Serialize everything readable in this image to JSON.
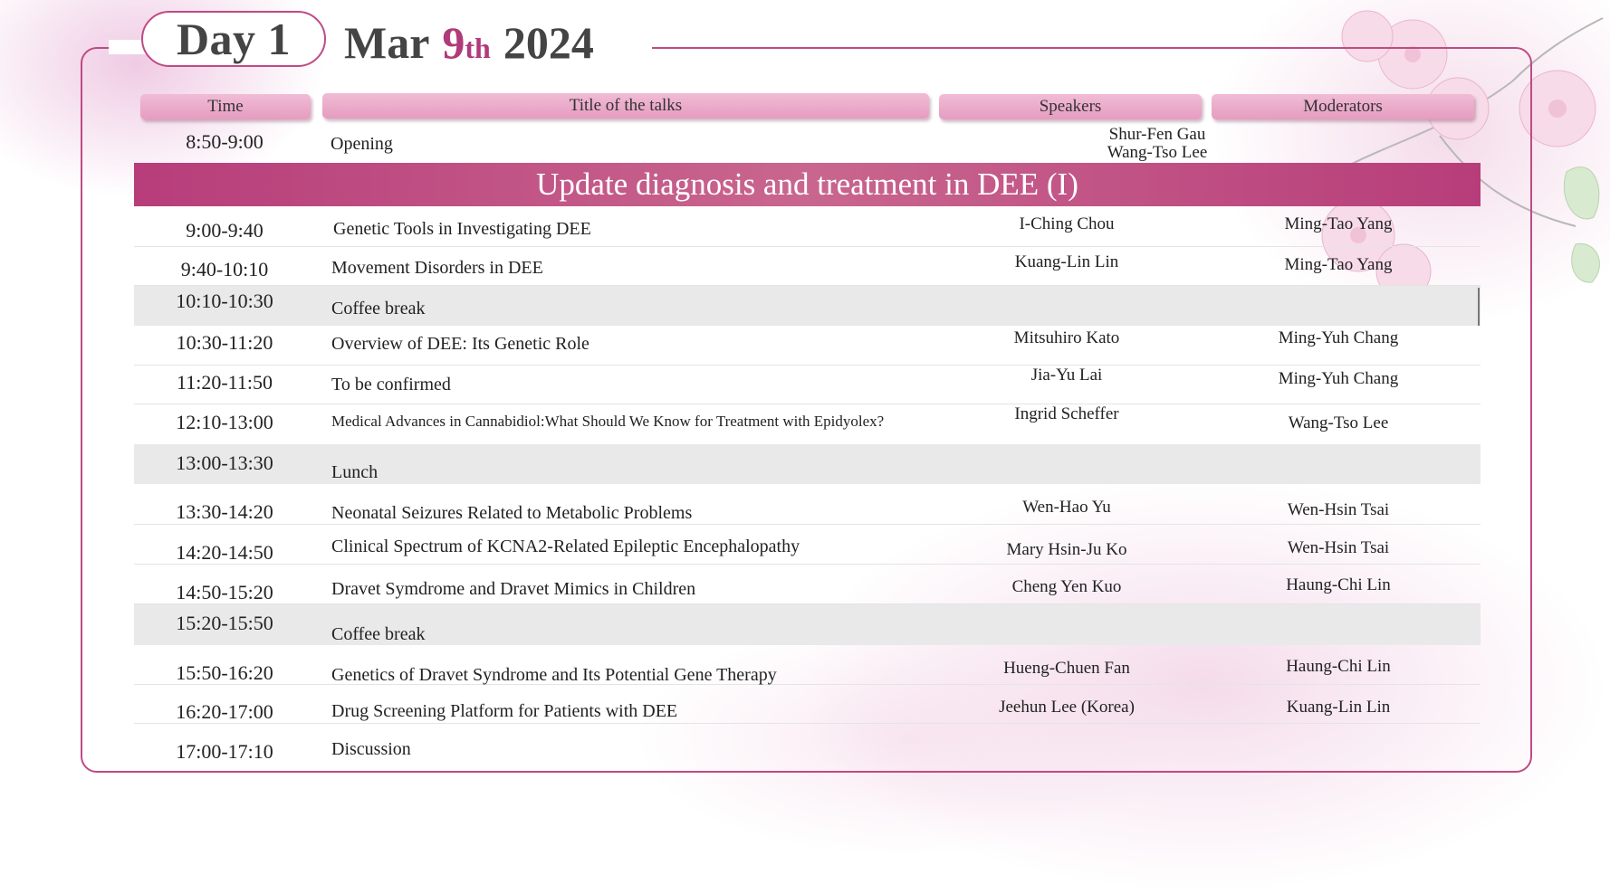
{
  "header": {
    "day_label": "Day 1",
    "month": "Mar",
    "day_number": "9",
    "day_suffix": "th",
    "year": "2024"
  },
  "columns": {
    "time": "Time",
    "title": "Title of the talks",
    "speakers": "Speakers",
    "moderators": "Moderators"
  },
  "opening": {
    "time": "8:50-9:00",
    "title": "Opening",
    "moderator_1": "Shur-Fen Gau",
    "moderator_2": "Wang-Tso Lee"
  },
  "section": {
    "title": "Update diagnosis and treatment in DEE (I)"
  },
  "rows": [
    {
      "time": "9:00-9:40",
      "title": "Genetic Tools in Investigating DEE",
      "speaker": "I-Ching Chou",
      "moderator": "Ming-Tao Yang"
    },
    {
      "time": "9:40-10:10",
      "title": "Movement Disorders in DEE",
      "speaker": "Kuang-Lin Lin",
      "moderator": "Ming-Tao Yang"
    },
    {
      "time": "10:10-10:30",
      "title": "Coffee break",
      "speaker": "",
      "moderator": ""
    },
    {
      "time": "10:30-11:20",
      "title": "Overview of DEE: Its Genetic Role",
      "speaker": "Mitsuhiro Kato",
      "moderator": "Ming-Yuh Chang"
    },
    {
      "time": "11:20-11:50",
      "title": "To be confirmed",
      "speaker": "Jia-Yu Lai",
      "moderator": "Ming-Yuh Chang"
    },
    {
      "time": "12:10-13:00",
      "title": "Medical Advances in Cannabidiol:What Should We Know for Treatment with Epidyolex?",
      "speaker": "Ingrid Scheffer",
      "moderator": "Wang-Tso Lee"
    },
    {
      "time": "13:00-13:30",
      "title": "Lunch",
      "speaker": "",
      "moderator": ""
    },
    {
      "time": "13:30-14:20",
      "title": "Neonatal Seizures Related to Metabolic Problems",
      "speaker": "Wen-Hao Yu",
      "moderator": "Wen-Hsin Tsai"
    },
    {
      "time": "14:20-14:50",
      "title": "Clinical Spectrum of  KCNA2-Related Epileptic Encephalopathy",
      "speaker": "Mary Hsin-Ju Ko",
      "moderator": "Wen-Hsin Tsai"
    },
    {
      "time": "14:50-15:20",
      "title": "Dravet Symdrome and Dravet Mimics in Children",
      "speaker": "Cheng Yen Kuo",
      "moderator": "Haung-Chi Lin"
    },
    {
      "time": "15:20-15:50",
      "title": "Coffee break",
      "speaker": "",
      "moderator": ""
    },
    {
      "time": "15:50-16:20",
      "title": "Genetics of  Dravet Syndrome and Its Potential Gene Therapy",
      "speaker": "Hueng-Chuen Fan",
      "moderator": "Haung-Chi Lin"
    },
    {
      "time": "16:20-17:00",
      "title": "Drug Screening Platform for Patients with DEE",
      "speaker": "Jeehun Lee (Korea)",
      "moderator": "Kuang-Lin Lin"
    },
    {
      "time": "17:00-17:10",
      "title": "Discussion",
      "speaker": "",
      "moderator": ""
    }
  ],
  "colors": {
    "accent": "#c04a84",
    "banner": "#b73d7a",
    "header_button": "#e59cc0",
    "shaded_row": "#e9e9e9"
  }
}
